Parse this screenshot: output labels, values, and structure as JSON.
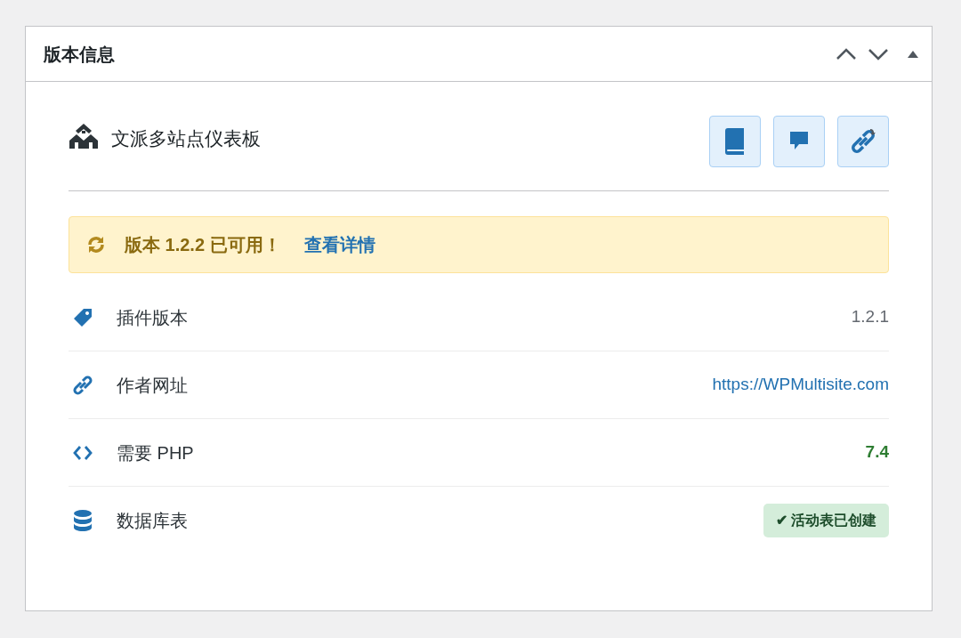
{
  "panel": {
    "title": "版本信息"
  },
  "plugin": {
    "name": "文派多站点仪表板"
  },
  "notice": {
    "message": "版本 1.2.2 已可用！",
    "link": "查看详情"
  },
  "rows": [
    {
      "label": "插件版本",
      "value": "1.2.1",
      "kind": "text"
    },
    {
      "label": "作者网址",
      "value": "https://WPMultisite.com",
      "kind": "link"
    },
    {
      "label": "需要 PHP",
      "value": "7.4",
      "kind": "good"
    },
    {
      "label": "数据库表",
      "value": "✔ 活动表已创建",
      "kind": "badge"
    }
  ]
}
